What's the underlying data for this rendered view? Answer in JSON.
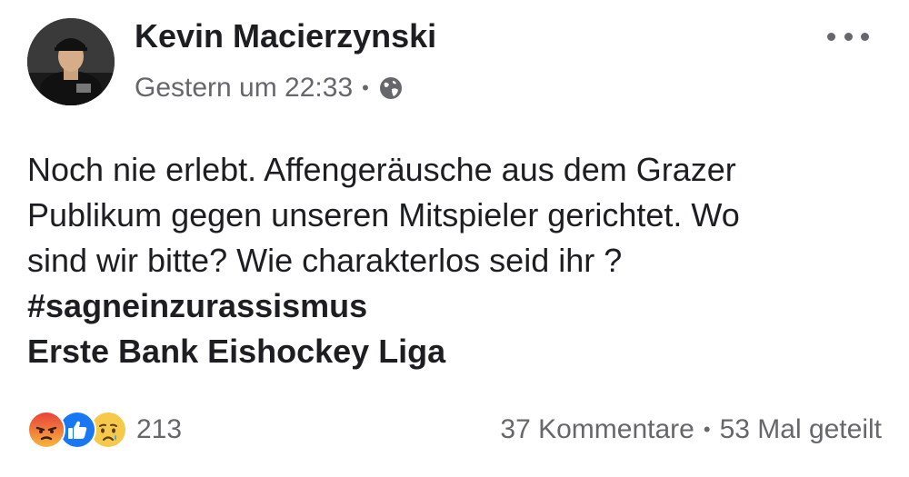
{
  "post": {
    "author": "Kevin Macierzynski",
    "timestamp": "Gestern um 22:33",
    "meta_separator": "•",
    "privacy_icon": "globe-icon",
    "more_icon": "more-options-icon",
    "body_lines": [
      "Noch nie erlebt. Affengeräusche aus dem Grazer",
      "Publikum gegen unseren Mitspieler gerichtet. Wo",
      "sind wir bitte? Wie charakterlos seid ihr ?"
    ],
    "hashtag": "#sagneinzurassismus",
    "page_tag": "Erste Bank Eishockey Liga"
  },
  "footer": {
    "reactions": [
      "angry",
      "like",
      "sad"
    ],
    "reaction_count": "213",
    "comments": "37 Kommentare",
    "separator": "•",
    "shares": "53 Mal geteilt"
  },
  "colors": {
    "text": "#1c1e21",
    "secondary": "#65676b",
    "like_blue": "#1877f2",
    "angry_orange": "#f0582c",
    "sad_yellow": "#f7c94b"
  }
}
